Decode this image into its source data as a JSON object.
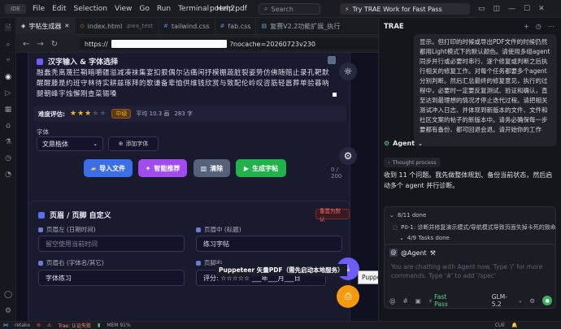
{
  "titlebar": {
    "logo": "IDE",
    "menus": [
      "File",
      "Edit",
      "Selection",
      "View",
      "Go",
      "Run",
      "Terminal",
      "Help"
    ],
    "project": "poem2pdf",
    "search_placeholder": "Search",
    "try_label": "Try TRAE Work for Fast Pass"
  },
  "tabs": [
    {
      "label": "字帖生成器",
      "active": true
    },
    {
      "label": "index.html",
      "extra": ".pwa_test"
    },
    {
      "label": "tailwind.css"
    },
    {
      "label": "fab.css"
    },
    {
      "label": "复赛V2.2功能扩展_执行"
    }
  ],
  "url": {
    "prefix": "https://",
    "suffix": "?nocache=20260723v230"
  },
  "section1": {
    "title": "汉字输入 & 字体选择",
    "text": "融蠢秃离蔑拦鞘暗嚼疆溢减凑袜集宴扣狠偶尔沾痛闲抒模棚蔬脏裂姿势仿佛随赔止录孔靶默醒醒藤是约班守林待实耕兹琢拜的歌谦备辈恤供维钱欣赏与致配伦岭叹咨筋轻嚣葬单验暮呐腿朝峰字烛懈刚查菜锡嗓",
    "difficulty_label": "难度评估:",
    "stars_filled": 3,
    "stars_total": 5,
    "level": "中级",
    "avg_label": "平均 10.3 画",
    "count_label": "283 字",
    "font_label": "字体",
    "font_value": "文鼎楷体",
    "add_font": "添加字体",
    "char_count": "0 / 200",
    "buttons": {
      "import": "导入文件",
      "recommend": "智能推荐",
      "clear": "清除",
      "generate": "生成字帖"
    }
  },
  "section2": {
    "title": "页眉 / 页脚 自定义",
    "reset": "重置为默认",
    "header_left_label": "页眉左 (日期时间)",
    "header_left_placeholder": "留空使用当前时间",
    "header_mid_label": "页眉中 (标题)",
    "header_mid_value": "练习字帖",
    "footer_left_label": "页眉右 (字体名/其它)",
    "footer_left_value": "字体练习",
    "footer_right_label": "页脚右",
    "footer_right_value": "评分: ☆☆☆☆☆  ___年___月___日"
  },
  "tooltip": "Puppeteer 矢量PDF（需先启动本地服务）",
  "colors": {
    "accent_purple": "#6d5cf6",
    "import_blue": "#3b6fe8",
    "recommend_purple": "#a24cf0",
    "clear_gray": "#55607a",
    "generate_green": "#22b24c",
    "fab_orange": "#f59a0e"
  },
  "panel": {
    "title": "TRAE",
    "bubble": "显示。但打印的时候或导出PDF文件的时候仍然都用Light模式下的默认颜色。请使用多组agent同步并行或必要时串行、逐个修复或判断之后执行相关的修复工作。对每个任务都要多个agent分别判断。然后汇总最终的修复意见，执行的过程中，必要时一定要反复测试、验证和确认，直至达到最理想的情况才停止迭代过程。请把相关测试冲入日志、并体现到新版本的文件、文件和社区文案的帖子的新版本中。请务必确保每一步要都有备份、都可回退会退。请开始你的工作",
    "agent": "Agent",
    "thought": "Thought process",
    "reply": "收到 11 个问题。我先做整体规划、备份当前状态，然后启动多个 agent 并行诊断。",
    "task_done": "8/11 done",
    "task_item": "P0-1: 诊断并修复演示模式/导航模式导致页面失掉卡死的致命问题",
    "task_sub": "4/9 Tasks done",
    "mention": "@Agent",
    "input_placeholder": "You are chatting with Agent now. Type '/' for more commands. Type '#' to add '/spec'",
    "fastpass": "Fast Pass",
    "model": "GLM-5.2"
  },
  "status": {
    "left": "retake",
    "err": "Trae: 认证失败",
    "mem": "MEM 91%",
    "right": "CUE"
  }
}
